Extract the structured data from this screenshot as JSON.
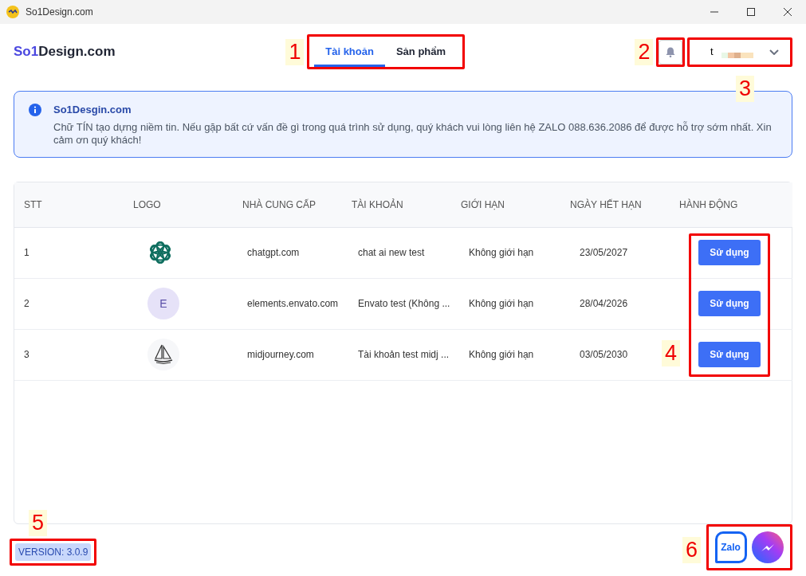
{
  "window": {
    "title": "So1Design.com"
  },
  "logo": {
    "accent": "So1",
    "rest": "Design.com"
  },
  "tabs": [
    {
      "label": "Tài khoản",
      "selected": true
    },
    {
      "label": "Sản phẩm",
      "selected": false
    }
  ],
  "user_menu": {
    "name": "t"
  },
  "alert": {
    "title": "So1Desgin.com",
    "message": "Chữ TÍN tạo dựng niềm tin. Nếu gặp bất cứ vấn đề gì trong quá trình sử dụng, quý khách vui lòng liên hệ ZALO 088.636.2086 để được hỗ trợ sớm nhất. Xin cảm ơn quý khách!"
  },
  "table": {
    "columns": [
      "STT",
      "LOGO",
      "NHÀ CUNG CẤP",
      "TÀI KHOẢN",
      "GIỚI HẠN",
      "NGÀY HẾT HẠN",
      "HÀNH ĐỘNG"
    ],
    "rows": [
      {
        "index": "1",
        "logo": {
          "kind": "knot"
        },
        "provider": "chatgpt.com",
        "account": "chat ai new test",
        "limit": "Không giới hạn",
        "expires": "23/05/2027",
        "action": "Sử dụng"
      },
      {
        "index": "2",
        "logo": {
          "kind": "letter",
          "text": "E"
        },
        "provider": "elements.envato.com",
        "account": "Envato test (Không ...",
        "limit": "Không giới hạn",
        "expires": "28/04/2026",
        "action": "Sử dụng"
      },
      {
        "index": "3",
        "logo": {
          "kind": "sailboat"
        },
        "provider": "midjourney.com",
        "account": "Tài khoản test midj ...",
        "limit": "Không giới hạn",
        "expires": "03/05/2030",
        "action": "Sử dụng"
      }
    ]
  },
  "version": "VERSION: 3.0.9",
  "contacts": {
    "zalo": "Zalo"
  },
  "annotations": [
    {
      "label": "1"
    },
    {
      "label": "2"
    },
    {
      "label": "3"
    },
    {
      "label": "4"
    },
    {
      "label": "5"
    },
    {
      "label": "6"
    }
  ]
}
